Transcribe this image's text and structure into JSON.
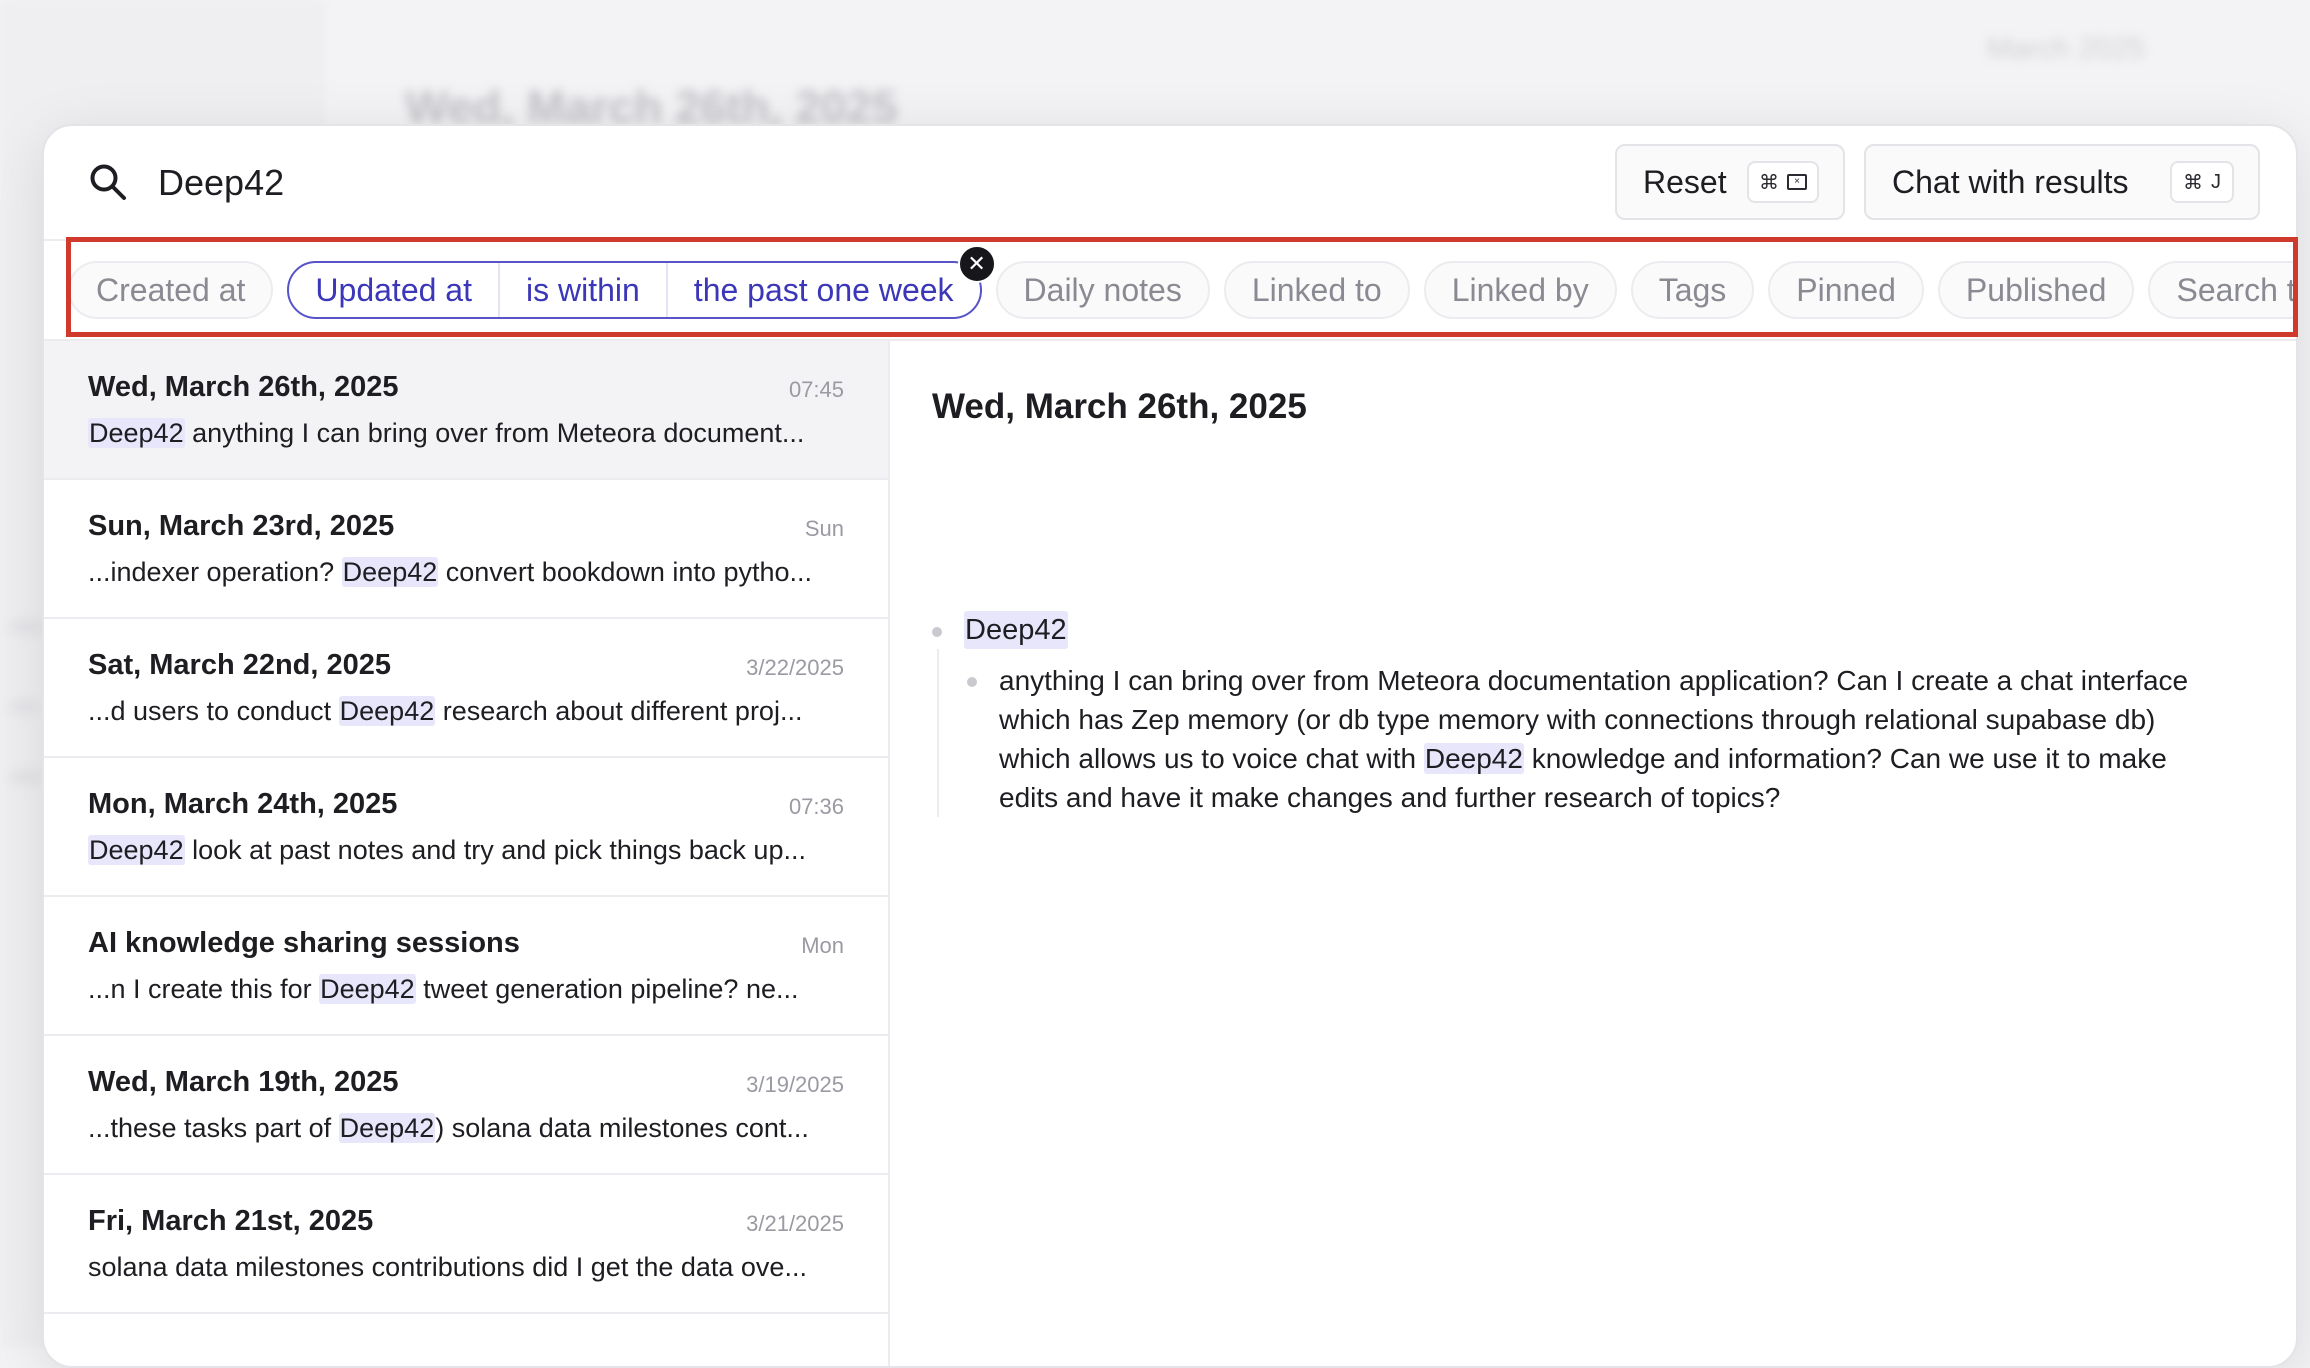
{
  "background": {
    "page_title": "Wed, March 26th, 2025",
    "corner_date": "March 2025"
  },
  "search": {
    "query": "Deep42",
    "reset_label": "Reset",
    "reset_shortcut": "⌘",
    "chat_label": "Chat with results",
    "chat_shortcut_mod": "⌘",
    "chat_shortcut_key": "J"
  },
  "filters": {
    "created_at": "Created at",
    "active": {
      "field": "Updated at",
      "operator": "is within",
      "value": "the past one week"
    },
    "chips": [
      "Daily notes",
      "Linked to",
      "Linked by",
      "Tags",
      "Pinned",
      "Published",
      "Search ty"
    ]
  },
  "results": [
    {
      "title": "Wed, March 26th, 2025",
      "time": "07:45",
      "pre": "",
      "match": "Deep42",
      "post": " anything I can bring over from Meteora document..."
    },
    {
      "title": "Sun, March 23rd, 2025",
      "time": "Sun",
      "pre": "...indexer operation? ",
      "match": "Deep42",
      "post": " convert bookdown into pytho..."
    },
    {
      "title": "Sat, March 22nd, 2025",
      "time": "3/22/2025",
      "pre": "...d users to conduct ",
      "match": "Deep42",
      "post": " research about different proj..."
    },
    {
      "title": "Mon, March 24th, 2025",
      "time": "07:36",
      "pre": "",
      "match": "Deep42",
      "post": " look at past notes and try and pick things back up..."
    },
    {
      "title": "AI knowledge sharing sessions",
      "time": "Mon",
      "pre": "...n I create this for ",
      "match": "Deep42",
      "post": " tweet generation pipeline? ne..."
    },
    {
      "title": "Wed, March 19th, 2025",
      "time": "3/19/2025",
      "pre": "...these tasks part of ",
      "match": "Deep42",
      "post": ") solana data milestones cont..."
    },
    {
      "title": "Fri, March 21st, 2025",
      "time": "3/21/2025",
      "pre": "solana data milestones contributions did I get the data ove...",
      "match": "",
      "post": ""
    }
  ],
  "preview": {
    "title": "Wed, March 26th, 2025",
    "bullet": "Deep42",
    "child_pre": "anything I can bring over from Meteora documentation application? Can I create a chat interface which has Zep memory (or db type memory with connections through relational supabase db) which allows us to voice chat with ",
    "child_match": "Deep42",
    "child_post": " knowledge and information? Can we use it to make edits and have it make changes and further research of topics?"
  },
  "colors": {
    "accent": "#5753c9",
    "highlight": "#e7e6fb",
    "annotation_box": "#cf3a2c"
  }
}
